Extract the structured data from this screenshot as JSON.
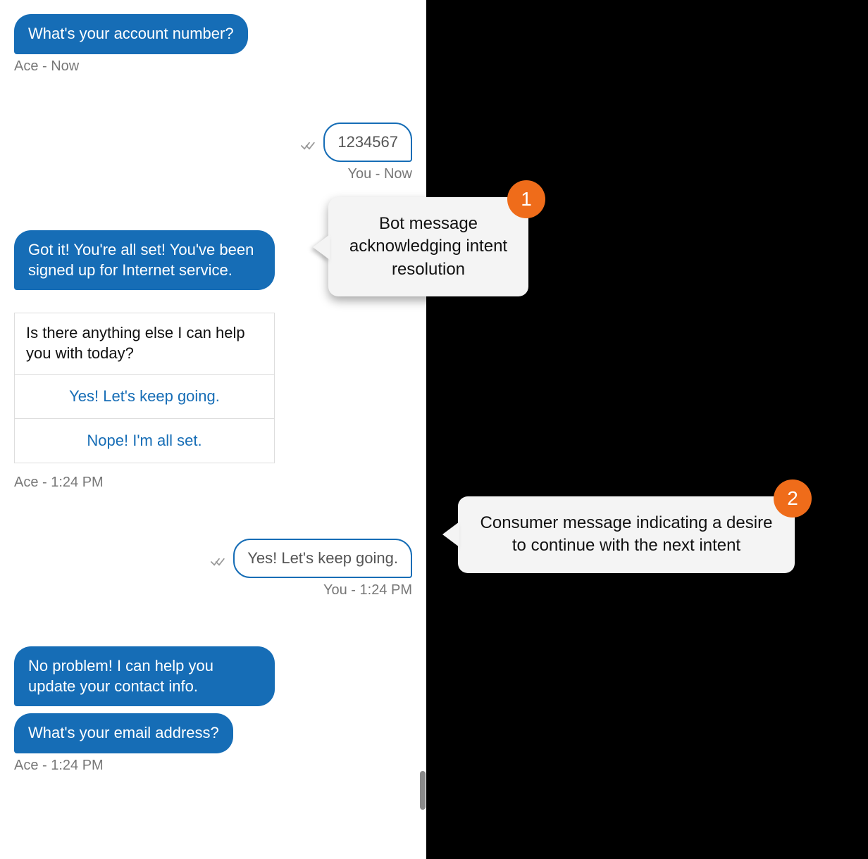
{
  "chat": {
    "agent_name": "Ace",
    "messages": [
      {
        "type": "agent",
        "text": "What's your account number?",
        "meta": "Ace - Now"
      },
      {
        "type": "user",
        "text": "1234567",
        "meta": "You - Now"
      },
      {
        "type": "agent",
        "text": "Got it! You're all set! You've been signed up for Internet service.",
        "meta": null
      },
      {
        "type": "options",
        "prompt": "Is there anything else I can help you with today?",
        "options": [
          "Yes! Let's keep going.",
          "Nope! I'm all set."
        ],
        "meta": "Ace - 1:24 PM"
      },
      {
        "type": "user",
        "text": "Yes! Let's keep going.",
        "meta": "You - 1:24 PM"
      },
      {
        "type": "agent_multi",
        "texts": [
          "No problem! I can help you update your contact info.",
          "What's your email address?"
        ],
        "meta": "Ace - 1:24 PM"
      }
    ]
  },
  "callouts": [
    {
      "number": "1",
      "text": "Bot message acknowledging intent resolution"
    },
    {
      "number": "2",
      "text": "Consumer message indicating a desire to continue with the next intent"
    }
  ]
}
